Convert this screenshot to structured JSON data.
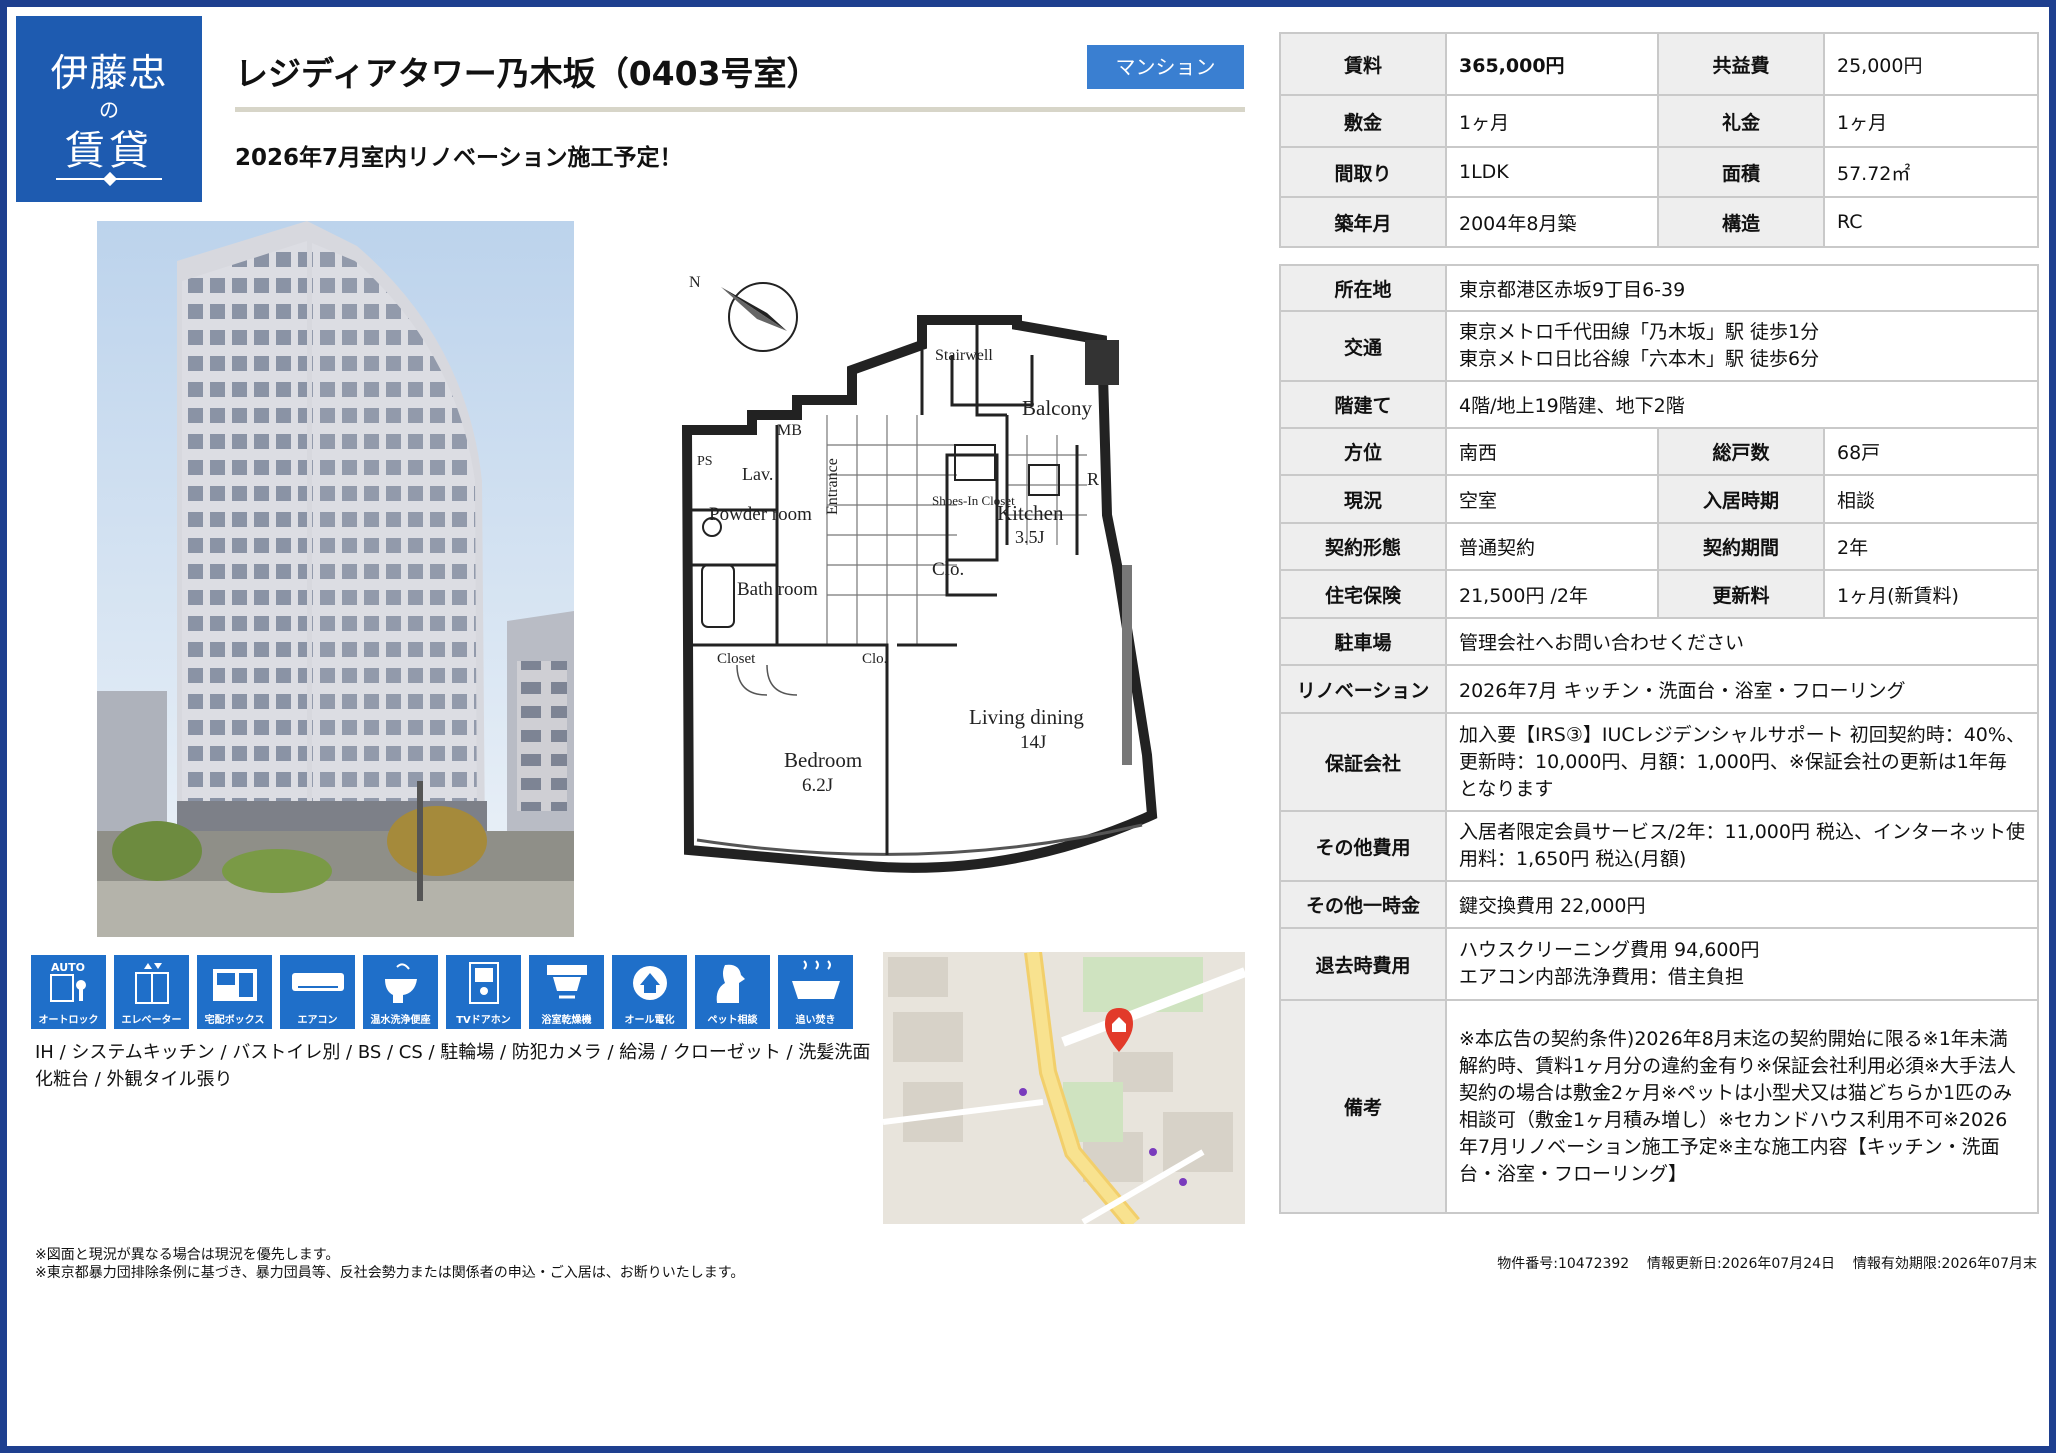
{
  "logo": {
    "line1": "伊藤忠",
    "line2": "の",
    "line3": "賃貸"
  },
  "header": {
    "title": "レジディアタワー乃木坂（0403号室）",
    "type_badge": "マンション",
    "subtitle": "2026年7月室内リノベーション施工予定！"
  },
  "floorplan": {
    "compass": "N",
    "labels": {
      "stairwell": "Stairwell",
      "balcony": "Balcony",
      "mb": "MB",
      "ps": "PS",
      "lav": "Lav.",
      "entrance": "Entrance",
      "powder_room": "Powder room",
      "shoes_in_closet": "Shoes-In Closet",
      "kitchen": "Kitchen",
      "kitchen_size": "3.5J",
      "r": "R",
      "clo1": "Clo.",
      "bath_room": "Bath room",
      "closet": "Closet",
      "clo2": "Clo.",
      "living_dining": "Living dining",
      "living_dining_size": "14J",
      "bedroom": "Bedroom",
      "bedroom_size": "6.2J"
    }
  },
  "features": [
    {
      "label": "オートロック",
      "icon": "auto-lock-icon",
      "caption": "AUTO"
    },
    {
      "label": "エレベーター",
      "icon": "elevator-icon"
    },
    {
      "label": "宅配ボックス",
      "icon": "delivery-box-icon"
    },
    {
      "label": "エアコン",
      "icon": "air-conditioner-icon"
    },
    {
      "label": "温水洗浄便座",
      "icon": "washlet-icon"
    },
    {
      "label": "TVドアホン",
      "icon": "tv-doorphone-icon"
    },
    {
      "label": "浴室乾燥機",
      "icon": "bathroom-dryer-icon"
    },
    {
      "label": "オール電化",
      "icon": "all-electric-icon"
    },
    {
      "label": "ペット相談",
      "icon": "pet-icon"
    },
    {
      "label": "追い焚き",
      "icon": "reheating-icon"
    }
  ],
  "equipment_text": "IH / システムキッチン / バストイレ別 / BS / CS / 駐輪場 / 防犯カメラ / 給湯 / クローゼット / 洗髪洗面化粧台 / 外観タイル張り",
  "footnotes": [
    "※図面と現況が異なる場合は現況を優先します。",
    "※東京都暴力団排除条例に基づき、暴力団員等、反社会勢力または関係者の申込・ご入居は、お断りいたします。"
  ],
  "meta": {
    "property_no": "物件番号:10472392",
    "updated": "情報更新日:2026年07月24日",
    "valid_until": "情報有効期限:2026年07月末"
  },
  "summary": {
    "rent_label": "賃料",
    "rent": "365,000円",
    "common_fee_label": "共益費",
    "common_fee": "25,000円",
    "deposit_label": "敷金",
    "deposit": "1ヶ月",
    "key_money_label": "礼金",
    "key_money": "1ヶ月",
    "layout_label": "間取り",
    "layout": "1LDK",
    "area_label": "面積",
    "area": "57.72㎡",
    "built_label": "築年月",
    "built": "2004年8月築",
    "structure_label": "構造",
    "structure": "RC"
  },
  "details": {
    "address_label": "所在地",
    "address": "東京都港区赤坂9丁目6-39",
    "transport_label": "交通",
    "transport_1": "東京メトロ千代田線「乃木坂」駅 徒歩1分",
    "transport_2": "東京メトロ日比谷線「六本木」駅 徒歩6分",
    "floors_label": "階建て",
    "floors": "4階/地上19階建、地下2階",
    "direction_label": "方位",
    "direction": "南西",
    "units_label": "総戸数",
    "units": "68戸",
    "status_label": "現況",
    "status": "空室",
    "move_in_label": "入居時期",
    "move_in": "相談",
    "contract_type_label": "契約形態",
    "contract_type": "普通契約",
    "contract_period_label": "契約期間",
    "contract_period": "2年",
    "insurance_label": "住宅保険",
    "insurance": "21,500円 /2年",
    "renewal_label": "更新料",
    "renewal": "1ヶ月(新賃料)",
    "parking_label": "駐車場",
    "parking": "管理会社へお問い合わせください",
    "renovation_label": "リノベーション",
    "renovation": "2026年7月 キッチン・洗面台・浴室・フローリング",
    "guarantor_label": "保証会社",
    "guarantor": "加入要【IRS③】IUCレジデンシャルサポート 初回契約時：40%、更新時：10,000円、月額：1,000円、※保証会社の更新は1年毎となります",
    "other_fees_label": "その他費用",
    "other_fees": "入居者限定会員サービス/2年：11,000円 税込、インターネット使用料：1,650円 税込(月額)",
    "other_onetime_label": "その他一時金",
    "other_onetime": "鍵交換費用 22,000円",
    "moveout_label": "退去時費用",
    "moveout_1": "ハウスクリーニング費用 94,600円",
    "moveout_2": "エアコン内部洗浄費用：借主負担",
    "remarks_label": "備考",
    "remarks": "※本広告の契約条件)2026年8月末迄の契約開始に限る※1年未満解約時、賃料1ヶ月分の違約金有り※保証会社利用必須※大手法人契約の場合は敷金2ヶ月※ペットは小型犬又は猫どちらか1匹のみ相談可（敷金1ヶ月積み増し）※セカンドハウス利用不可※2026年7月リノベーション施工予定※主な施工内容【キッチン・洗面台・浴室・フローリング】"
  },
  "colors": {
    "brand_blue": "#1e5bb0",
    "badge_blue": "#3a7fd1",
    "feature_blue": "#1f6fc9",
    "border_navy": "#1e3f8f"
  }
}
